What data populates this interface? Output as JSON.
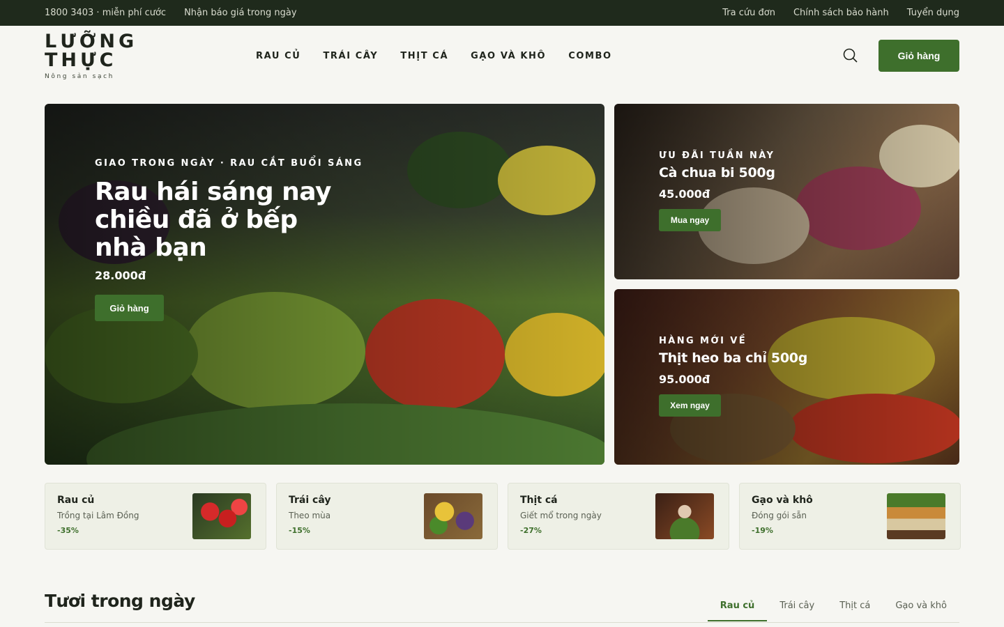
{
  "topbar": {
    "hotline": "1800 3403 · miễn phí cước",
    "quote": "Nhận báo giá trong ngày",
    "track": "Tra cứu đơn",
    "warranty": "Chính sách bảo hành",
    "jobs": "Tuyển dụng"
  },
  "header": {
    "logo_name": "LƯỠNG THỰC",
    "logo_tagline": "Nông sản sạch",
    "nav": [
      "RAU CỦ",
      "TRÁI CÂY",
      "THỊT CÁ",
      "GẠO VÀ KHÔ",
      "COMBO"
    ],
    "search_icon": "search-icon",
    "cart_label": "Giỏ hàng"
  },
  "hero": {
    "eyebrow": "GIAO TRONG NGÀY · RAU CẮT BUỔI SÁNG",
    "title": "Rau hái sáng nay chiều đã ở bếp nhà bạn",
    "price": "28.000đ",
    "button": "Giỏ hàng"
  },
  "promos": [
    {
      "eyebrow": "ƯU ĐÃI TUẦN NÀY",
      "title": "Cà chua bi 500g",
      "price": "45.000đ",
      "button": "Mua ngay"
    },
    {
      "eyebrow": "HÀNG MỚI VỀ",
      "title": "Thịt heo ba chỉ 500g",
      "price": "95.000đ",
      "button": "Xem ngay"
    }
  ],
  "categories": [
    {
      "title": "Rau củ",
      "subtitle": "Trồng tại Lâm Đồng",
      "discount": "-35%"
    },
    {
      "title": "Trái cây",
      "subtitle": "Theo mùa",
      "discount": "-15%"
    },
    {
      "title": "Thịt cá",
      "subtitle": "Giết mổ trong ngày",
      "discount": "-27%"
    },
    {
      "title": "Gạo và khô",
      "subtitle": "Đóng gói sẵn",
      "discount": "-19%"
    }
  ],
  "section": {
    "title": "Tươi trong ngày",
    "tabs": [
      "Rau củ",
      "Trái cây",
      "Thịt cá",
      "Gạo và khô"
    ],
    "active_tab": "Rau củ"
  },
  "colors": {
    "brand": "#3e6f2c",
    "topbar": "#1f2a1c",
    "background": "#f6f6f2"
  }
}
